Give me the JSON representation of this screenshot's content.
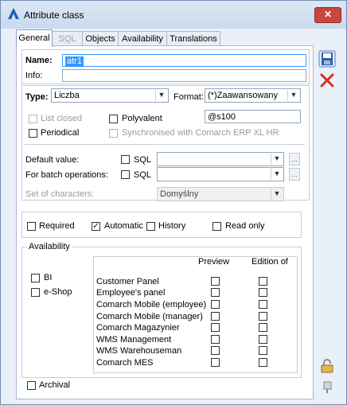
{
  "window": {
    "title": "Attribute class"
  },
  "tabs": [
    {
      "label": "General",
      "active": true
    },
    {
      "label": "SQL",
      "disabled": true
    },
    {
      "label": "Objects"
    },
    {
      "label": "Availability"
    },
    {
      "label": "Translations"
    }
  ],
  "general": {
    "name_label": "Name:",
    "name_value": "atr1",
    "info_label": "Info:",
    "info_value": "",
    "type_label": "Type:",
    "type_value": "Liczba",
    "format_label": "Format:",
    "format_value": "(*)Zaawansowany",
    "list_closed_label": "List closed",
    "polyvalent_label": "Polyvalent",
    "format_pattern": "@s100",
    "periodical_label": "Periodical",
    "synchronised_label": "Synchronised with Comarch ERP XL HR",
    "default_value_label": "Default value:",
    "batch_operations_label": "For batch operations:",
    "sql_label": "SQL",
    "charset_label": "Set of characters:",
    "charset_value": "Domyślny"
  },
  "flags": {
    "required": "Required",
    "automatic": "Automatic",
    "history": "History",
    "read_only": "Read only"
  },
  "availability": {
    "group_label": "Availability",
    "bi_label": "BI",
    "eshop_label": "e-Shop",
    "col_preview": "Preview",
    "col_edition": "Edition of",
    "rows": [
      "Customer Panel",
      "Employee's panel",
      "Comarch Mobile (employee)",
      "Comarch Mobile (manager)",
      "Comarch Magazynier",
      "WMS Management",
      "WMS Warehouseman",
      "Comarch MES"
    ]
  },
  "archival_label": "Archival",
  "icons": {
    "app": "comarch-logo-icon",
    "save": "save-disk-icon",
    "cancel": "cancel-x-icon",
    "lock": "padlock-icon",
    "pin": "pin-icon"
  },
  "colors": {
    "accent": "#3399ff",
    "cancel": "#e02a1f"
  }
}
